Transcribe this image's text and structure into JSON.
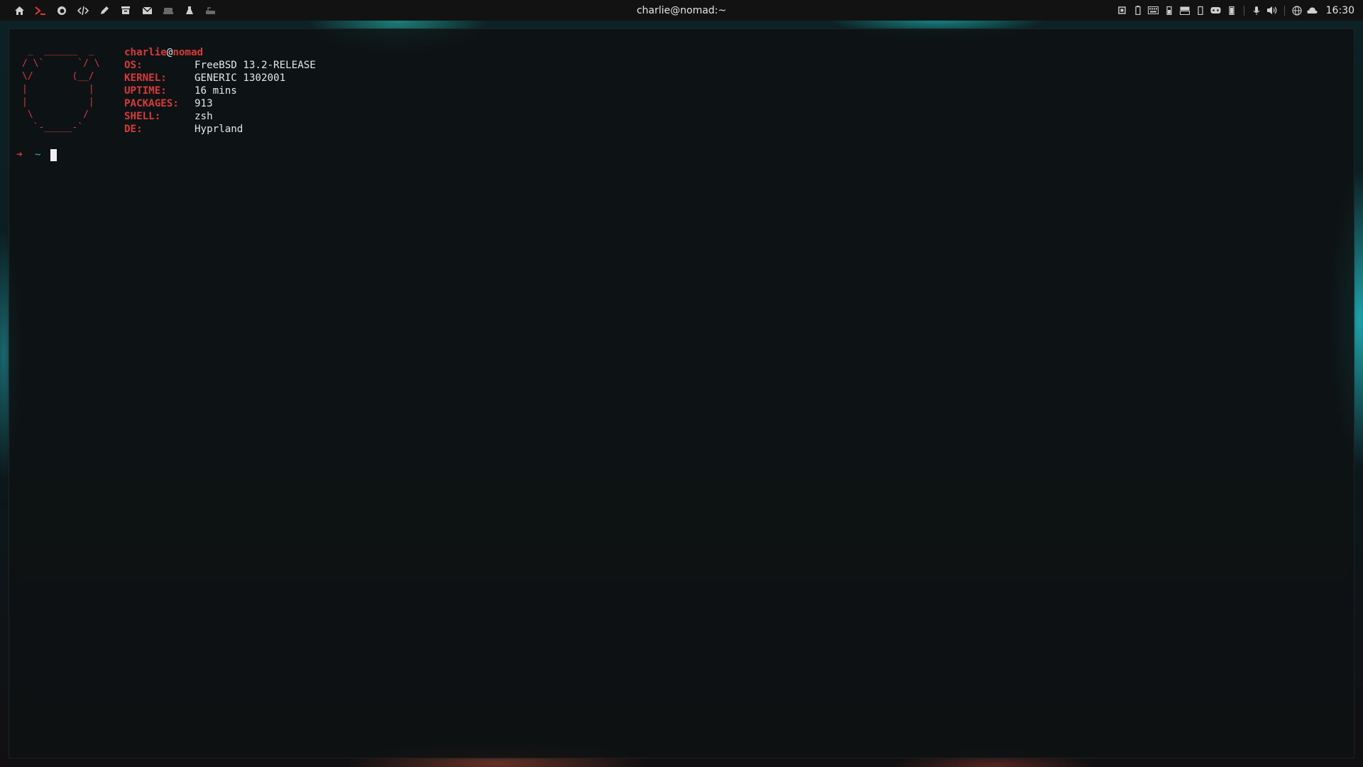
{
  "topbar": {
    "left_icons": [
      "home-icon",
      "terminal-icon",
      "firefox-icon",
      "code-icon",
      "pen-icon",
      "archive-icon",
      "mail-icon",
      "device-icon",
      "flask-icon",
      "keyboard-icon"
    ],
    "window_title": "charlie@nomad:~",
    "tray_icons": [
      "cpu-icon",
      "battery-icon",
      "keyboard-layout-icon",
      "battery-small-icon",
      "storage-icon",
      "battery-tall-icon",
      "gamepad-icon",
      "battery-tiny-icon",
      "microphone-icon",
      "volume-icon",
      "globe-icon",
      "cloud-icon"
    ],
    "clock": "16:30"
  },
  "terminal": {
    "ascii_logo": " _  ______  _\n/ \\`      `/ \\\n\\/       (__/\n|           |\n|           |\n \\         /\n  `-_____-`",
    "user": "charlie",
    "at": "@",
    "host": "nomad",
    "info": [
      {
        "key": "OS:",
        "value": "FreeBSD 13.2-RELEASE"
      },
      {
        "key": "KERNEL:",
        "value": "GENERIC 1302001"
      },
      {
        "key": "UPTIME:",
        "value": "16 mins"
      },
      {
        "key": "PACKAGES:",
        "value": "913"
      },
      {
        "key": "SHELL:",
        "value": "zsh"
      },
      {
        "key": "DE:",
        "value": "Hyprland"
      }
    ],
    "prompt_arrow": "➜",
    "prompt_dir": "~"
  },
  "colors": {
    "accent_red": "#d83a3a",
    "prompt_cyan": "#3fb6a8",
    "topbar_bg": "#121212"
  }
}
